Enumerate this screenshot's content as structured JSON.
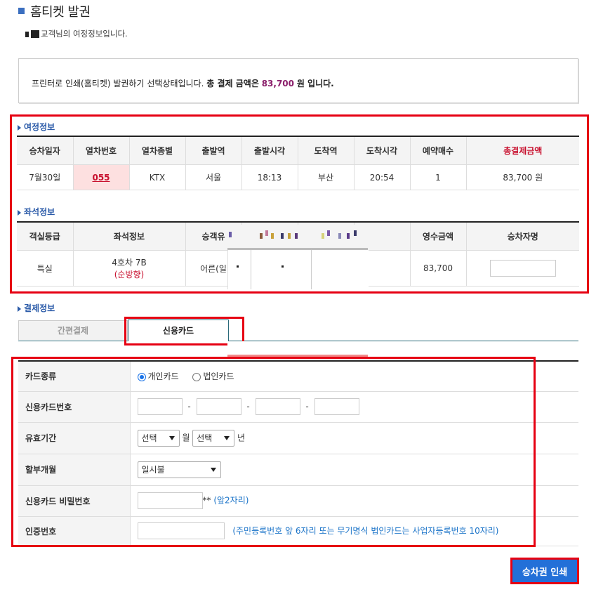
{
  "page": {
    "title": "홈티켓 발권",
    "greeting_suffix": "교객님의 여정정보입니다."
  },
  "notice": {
    "prefix": "프린터로 인쇄(홈티켓) 발권하기 선택상태입니다.",
    "bold_label": "총 결제 금액은",
    "amount": "83,700",
    "suffix": "원 입니다."
  },
  "journey": {
    "section_title": "여정정보",
    "headers": [
      "승차일자",
      "열차번호",
      "열차종별",
      "출발역",
      "출발시각",
      "도착역",
      "도착시각",
      "예약매수",
      "총결제금액"
    ],
    "row": {
      "date": "7월30일",
      "train_no": "055",
      "train_type": "KTX",
      "dep_station": "서울",
      "dep_time": "18:13",
      "arr_station": "부산",
      "arr_time": "20:54",
      "count": "1",
      "total": "83,700 원"
    }
  },
  "seat": {
    "section_title": "좌석정보",
    "headers": [
      "객실등급",
      "좌석정보",
      "승객유",
      "영수금액",
      "승차자명"
    ],
    "row": {
      "class": "특실",
      "seat": "4호차 7B",
      "direction": "(순방향)",
      "passenger": "어른(일",
      "receipt": "83,700"
    }
  },
  "payment": {
    "section_title": "결제정보",
    "tabs": [
      "간편결제",
      "신용카드"
    ],
    "active_tab": "신용카드",
    "fields": {
      "card_type": {
        "label": "카드종류",
        "options": [
          "개인카드",
          "법인카드"
        ],
        "selected": "개인카드"
      },
      "card_number": {
        "label": "신용카드번호",
        "separator": "-"
      },
      "expiry": {
        "label": "유효기간",
        "month_value": "선택",
        "month_unit": "월",
        "year_value": "선택",
        "year_unit": "년"
      },
      "installment": {
        "label": "할부개월",
        "value": "일시불"
      },
      "password": {
        "label": "신용카드 비밀번호",
        "mask": "**",
        "hint": "(앞2자리)"
      },
      "auth": {
        "label": "인증번호",
        "hint": "(주민등록번호 앞 6자리 또는 무기명식 법인카드는 사업자등록번호 10자리)"
      }
    }
  },
  "actions": {
    "print_button": "승차권 인쇄"
  },
  "colors": {
    "accent_blue": "#2370d8",
    "highlight_red": "#e60012",
    "amount_purple": "#8b1f6b"
  }
}
